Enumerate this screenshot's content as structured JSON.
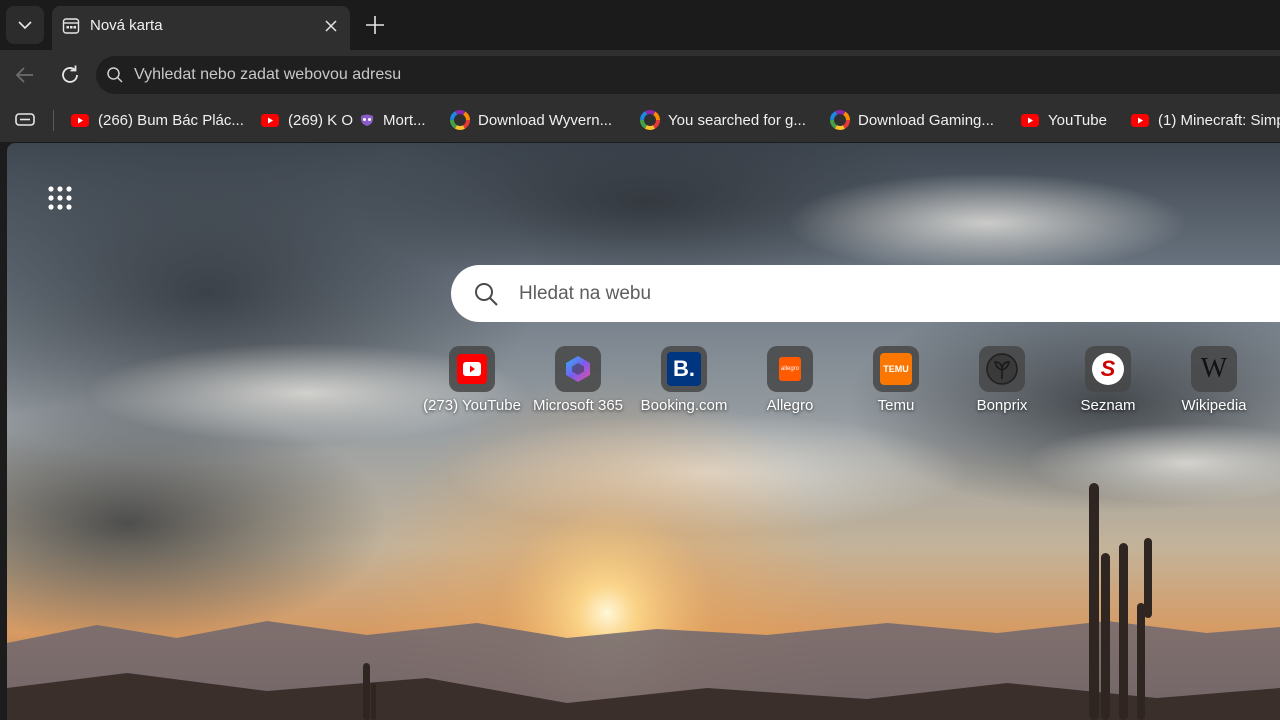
{
  "tabstrip": {
    "tab_title": "Nová karta"
  },
  "toolbar": {
    "address_placeholder": "Vyhledat nebo zadat webovou adresu"
  },
  "bookmarks": [
    {
      "label": "(266) Bum Bác Plác...",
      "icon": "youtube-icon"
    },
    {
      "label": "(269) K O",
      "icon": "youtube-icon",
      "extra_label": "Mort...",
      "extra_icon": "mask-icon"
    },
    {
      "label": "Download Wyvern...",
      "icon": "colorwheel-icon"
    },
    {
      "label": "You searched for g...",
      "icon": "colorwheel-icon"
    },
    {
      "label": "Download Gaming...",
      "icon": "colorwheel-icon"
    },
    {
      "label": "YouTube",
      "icon": "youtube-icon"
    },
    {
      "label": "(1) Minecraft: Simp",
      "icon": "youtube-icon"
    }
  ],
  "ntp": {
    "search_placeholder": "Hledat na webu",
    "quick_links": [
      {
        "label": "(273) YouTube",
        "icon": "youtube-icon"
      },
      {
        "label": "Microsoft 365",
        "icon": "microsoft365-icon"
      },
      {
        "label": "Booking.com",
        "icon": "booking-icon",
        "icon_text": "B."
      },
      {
        "label": "Allegro",
        "icon": "allegro-icon",
        "icon_text": "allegro"
      },
      {
        "label": "Temu",
        "icon": "temu-icon",
        "icon_text": "TEMU"
      },
      {
        "label": "Bonprix",
        "icon": "bonprix-icon"
      },
      {
        "label": "Seznam",
        "icon": "seznam-icon",
        "icon_text": "S"
      },
      {
        "label": "Wikipedia",
        "icon": "wikipedia-icon",
        "icon_text": "W"
      }
    ]
  },
  "colors": {
    "tabstrip_bg": "#1b1b1b",
    "toolbar_bg": "#2f2f2f",
    "youtube_red": "#ff0000",
    "booking_blue": "#003580",
    "allegro_orange": "#ff5a00",
    "temu_orange": "#fb7701",
    "seznam_red": "#cc0000"
  }
}
